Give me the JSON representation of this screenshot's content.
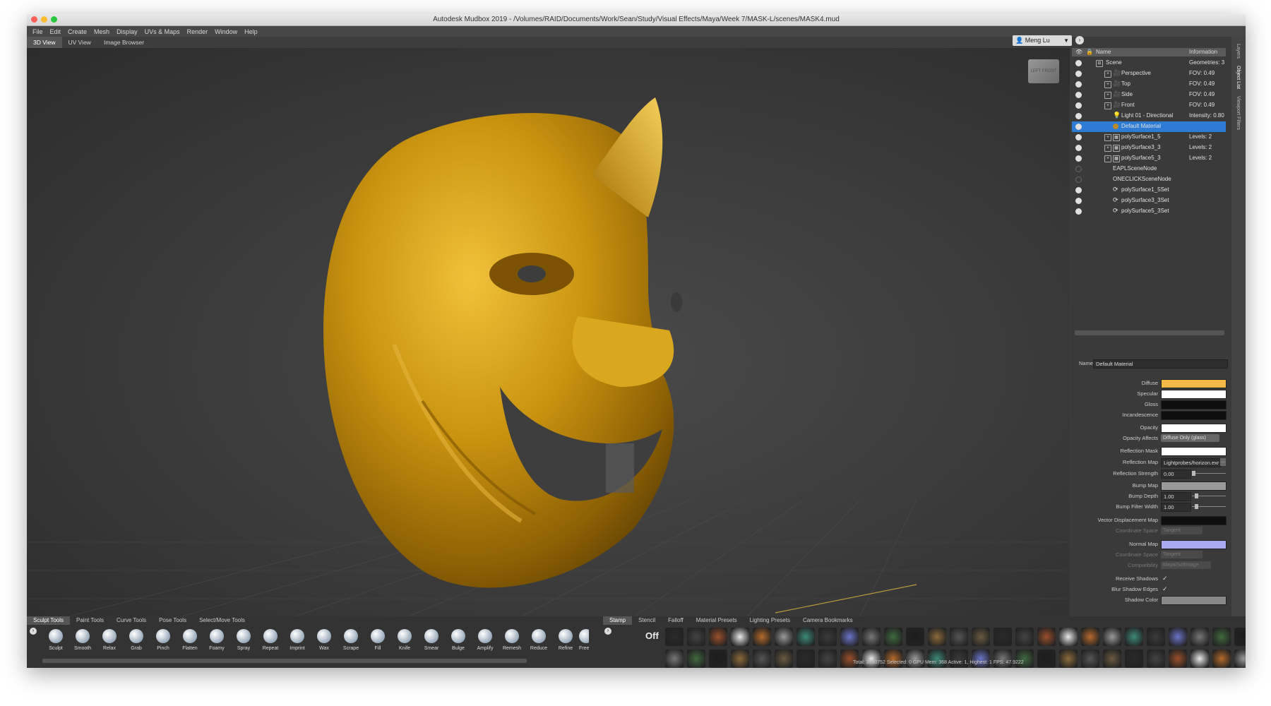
{
  "window": {
    "title": "Autodesk Mudbox 2019 - /Volumes/RAID/Documents/Work/Sean/Study/Visual Effects/Maya/Week 7/MASK-L/scenes/MASK4.mud",
    "traffic_colors": [
      "#fc5f57",
      "#fdbc2e",
      "#28c840"
    ]
  },
  "menu": [
    "File",
    "Edit",
    "Create",
    "Mesh",
    "Display",
    "UVs & Maps",
    "Render",
    "Window",
    "Help"
  ],
  "view_tabs": [
    "3D View",
    "UV View",
    "Image Browser"
  ],
  "user": "Meng Lu",
  "side_tabs": [
    "Layers",
    "Object List",
    "Viewport Filters"
  ],
  "outliner": {
    "headers": {
      "name": "Name",
      "info": "Information"
    },
    "rows": [
      {
        "name": "Scene",
        "info": "Geometries: 3"
      },
      {
        "name": "Perspective",
        "info": "FOV: 0.49"
      },
      {
        "name": "Top",
        "info": "FOV: 0.49"
      },
      {
        "name": "Side",
        "info": "FOV: 0.49"
      },
      {
        "name": "Front",
        "info": "FOV: 0.49"
      },
      {
        "name": "Light 01 - Directional",
        "info": "Intensity: 0.80"
      },
      {
        "name": "Default Material",
        "info": ""
      },
      {
        "name": "polySurface1_5",
        "info": "Levels: 2"
      },
      {
        "name": "polySurface3_3",
        "info": "Levels: 2"
      },
      {
        "name": "polySurface5_3",
        "info": "Levels: 2"
      },
      {
        "name": "EAPLSceneNode",
        "info": ""
      },
      {
        "name": "ONECLICKSceneNode",
        "info": ""
      },
      {
        "name": "polySurface1_5Set",
        "info": ""
      },
      {
        "name": "polySurface3_3Set",
        "info": ""
      },
      {
        "name": "polySurface5_3Set",
        "info": ""
      }
    ]
  },
  "properties": {
    "name_label": "Name",
    "name_value": "Default Material",
    "diffuse": "Diffuse",
    "specular": "Specular",
    "gloss": "Gloss",
    "incandescence": "Incandescence",
    "opacity": "Opacity",
    "opacity_affects": "Opacity Affects",
    "opacity_affects_value": "Diffuse Only (glass)",
    "reflection_mask": "Reflection Mask",
    "reflection_map": "Reflection Map",
    "reflection_map_value": "Lightprobes/horizon.exr",
    "reflection_strength": "Reflection Strength",
    "reflection_strength_value": "0.00",
    "bump_map": "Bump Map",
    "bump_depth": "Bump Depth",
    "bump_depth_value": "1.00",
    "bump_filter_width": "Bump Filter Width",
    "bump_filter_width_value": "1.00",
    "vector_displacement_map": "Vector Displacement Map",
    "coordinate_space": "Coordinate Space",
    "coordinate_space_value": "Tangent",
    "normal_map": "Normal Map",
    "compatibility": "Compatibility",
    "compatibility_value": "Maya/Softimage",
    "receive_shadows": "Receive Shadows",
    "blur_shadow_edges": "Blur Shadow Edges",
    "shadow_color": "Shadow Color",
    "check": "✓",
    "colors": {
      "diffuse": "#f5b945",
      "specular": "#ffffff",
      "gloss": "#0e0e0e",
      "incandescence": "#0e0e0e",
      "opacity": "#ffffff",
      "reflection_mask": "#ffffff",
      "bump_map": "#9a9a9a",
      "vector_displacement": "#0e0e0e",
      "normal_map": "#a9a9f2"
    }
  },
  "bottom_tabs_left": [
    "Sculpt Tools",
    "Paint Tools",
    "Curve Tools",
    "Pose Tools",
    "Select/Move Tools"
  ],
  "bottom_tabs_right": [
    "Stamp",
    "Stencil",
    "Falloff",
    "Material Presets",
    "Lighting Presets",
    "Camera Bookmarks"
  ],
  "sculpt_tools": [
    "Sculpt",
    "Smooth",
    "Relax",
    "Grab",
    "Pinch",
    "Flatten",
    "Foamy",
    "Spray",
    "Repeat",
    "Imprint",
    "Wax",
    "Scrape",
    "Fill",
    "Knife",
    "Smear",
    "Bulge",
    "Amplify",
    "Remesh",
    "Reduce",
    "Refine",
    "Free"
  ],
  "stamp_off": "Off",
  "status": "Total: 3530752  Selected: 0 GPU Mem: 368  Active: 1, Highest: 1  FPS: 47.9222",
  "cube_label": "LEFT FRONT"
}
